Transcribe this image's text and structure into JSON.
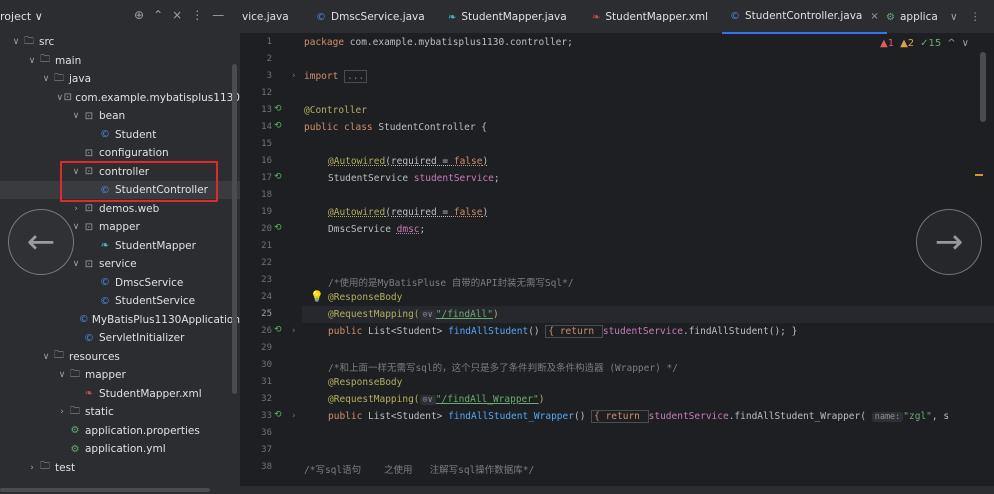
{
  "project": {
    "title": "roject ∨",
    "tools": [
      "⊕",
      "⌃",
      "×",
      "⋮",
      "—"
    ],
    "tree": [
      {
        "label": "src",
        "icon": "folder-icon",
        "depth": 1,
        "chev": "∨"
      },
      {
        "label": "main",
        "icon": "folder-icon",
        "depth": 2,
        "chev": "∨"
      },
      {
        "label": "java",
        "icon": "folder-icon",
        "depth": 3,
        "chev": "∨"
      },
      {
        "label": "com.example.mybatisplus1130",
        "icon": "package-icon",
        "depth": 4,
        "chev": "∨"
      },
      {
        "label": "bean",
        "icon": "package-icon",
        "depth": 5,
        "chev": "∨"
      },
      {
        "label": "Student",
        "icon": "class-icon",
        "depth": 6,
        "chev": ""
      },
      {
        "label": "configuration",
        "icon": "package-icon",
        "depth": 5,
        "chev": ""
      },
      {
        "label": "controller",
        "icon": "package-icon",
        "depth": 5,
        "chev": "∨"
      },
      {
        "label": "StudentController",
        "icon": "class-icon",
        "depth": 6,
        "chev": "",
        "selected": true
      },
      {
        "label": "demos.web",
        "icon": "package-icon",
        "depth": 5,
        "chev": "›"
      },
      {
        "label": "mapper",
        "icon": "package-icon",
        "depth": 5,
        "chev": "∨"
      },
      {
        "label": "StudentMapper",
        "icon": "mapper-icon",
        "depth": 6,
        "chev": ""
      },
      {
        "label": "service",
        "icon": "package-icon",
        "depth": 5,
        "chev": "∨"
      },
      {
        "label": "DmscService",
        "icon": "class-icon",
        "depth": 6,
        "chev": ""
      },
      {
        "label": "StudentService",
        "icon": "class-icon",
        "depth": 6,
        "chev": ""
      },
      {
        "label": "MyBatisPlus1130Application",
        "icon": "spring-class-icon",
        "depth": 5,
        "chev": ""
      },
      {
        "label": "ServletInitializer",
        "icon": "class-icon",
        "depth": 5,
        "chev": ""
      },
      {
        "label": "resources",
        "icon": "resources-folder-icon",
        "depth": 3,
        "chev": "∨"
      },
      {
        "label": "mapper",
        "icon": "folder-icon",
        "depth": 4,
        "chev": "∨"
      },
      {
        "label": "StudentMapper.xml",
        "icon": "xml-icon",
        "depth": 5,
        "chev": ""
      },
      {
        "label": "static",
        "icon": "folder-icon",
        "depth": 4,
        "chev": "›"
      },
      {
        "label": "application.properties",
        "icon": "properties-icon",
        "depth": 4,
        "chev": ""
      },
      {
        "label": "application.yml",
        "icon": "properties-icon",
        "depth": 4,
        "chev": ""
      },
      {
        "label": "test",
        "icon": "folder-icon",
        "depth": 2,
        "chev": "›"
      }
    ]
  },
  "tabs": [
    {
      "label": "vice.java",
      "icon": "",
      "active": false
    },
    {
      "label": "DmscService.java",
      "icon": "class-icon",
      "active": false
    },
    {
      "label": "StudentMapper.java",
      "icon": "mapper-icon",
      "active": false
    },
    {
      "label": "StudentMapper.xml",
      "icon": "xml-icon",
      "active": false
    },
    {
      "label": "StudentController.java",
      "icon": "class-icon",
      "active": true
    },
    {
      "label": "applica",
      "icon": "properties-icon",
      "active": false
    }
  ],
  "tab_overflow": "∨",
  "tab_menu": "⋮",
  "tab_close": "×",
  "inspections": {
    "errors": "▲1",
    "warnings": "▲2",
    "checks": "✓15",
    "up": "^",
    "down": "∨"
  },
  "editor": {
    "lines": [
      {
        "num": "1"
      },
      {
        "num": "2"
      },
      {
        "num": "3"
      },
      {
        "num": "12"
      },
      {
        "num": "13"
      },
      {
        "num": "14"
      },
      {
        "num": "15"
      },
      {
        "num": "16"
      },
      {
        "num": "17"
      },
      {
        "num": "18"
      },
      {
        "num": "19"
      },
      {
        "num": "20"
      },
      {
        "num": "21"
      },
      {
        "num": "22"
      },
      {
        "num": "23"
      },
      {
        "num": "24"
      },
      {
        "num": "25"
      },
      {
        "num": "26"
      },
      {
        "num": "29"
      },
      {
        "num": "30"
      },
      {
        "num": "31"
      },
      {
        "num": "32"
      },
      {
        "num": "33"
      },
      {
        "num": "36"
      },
      {
        "num": "37"
      },
      {
        "num": "38"
      }
    ],
    "code": {
      "l1_kw": "package",
      "l1_rest": " com.example.mybatisplus1130.controller;",
      "l3_kw": "import",
      "l3_fold": "...",
      "l13": "@Controller",
      "l14_kw": "public class",
      "l14_rest": " StudentController {",
      "l16_ann": "@Autowired",
      "l16_rest": "(required = ",
      "l16_val": "false",
      "l16_end": ")",
      "l17_type": "StudentService ",
      "l17_field": "studentService",
      "l17_end": ";",
      "l19_ann": "@Autowired",
      "l19_rest": "(required = ",
      "l19_val": "false",
      "l19_end": ")",
      "l20_type": "DmscService ",
      "l20_field": "dmsc",
      "l20_end": ";",
      "l23": "/*使用的是MyBatisPluse 自带的API封装无需写Sql*/",
      "l24": "@ResponseBody",
      "l25_ann": "@RequestMapping(",
      "l25_hint": "⊙∨",
      "l25_str": "\"/findAll\"",
      "l25_end": ")",
      "l26_kw": "public",
      "l26_type": " List<Student> ",
      "l26_fn": "findAllStudent",
      "l26_paren": "() ",
      "l26_body_kw": "{ return ",
      "l26_field": "studentService",
      "l26_call": ".findAllStudent(); }",
      "l30": "/*和上面一样无需写sql的，这个只是多了条件判断及条件构造器 (Wrapper) */",
      "l31": "@ResponseBody",
      "l32_ann": "@RequestMapping(",
      "l32_hint": "⊙∨",
      "l32_str": "\"/findAll_Wrapper\"",
      "l32_end": ")",
      "l33_kw": "public",
      "l33_type": " List<Student> ",
      "l33_fn": "findAllStudent_Wrapper",
      "l33_paren": "() ",
      "l33_body_kw": "{ return ",
      "l33_field": "studentService",
      "l33_call": ".findAllStudent_Wrapper( ",
      "l33_hint": "name:",
      "l33_str": "\"zgl\"",
      "l33_tail": ", s",
      "l38": "/*写sql语句    之使用   注解写sql操作数据库*/"
    }
  },
  "nav": {
    "back": "←",
    "forward": "→"
  }
}
